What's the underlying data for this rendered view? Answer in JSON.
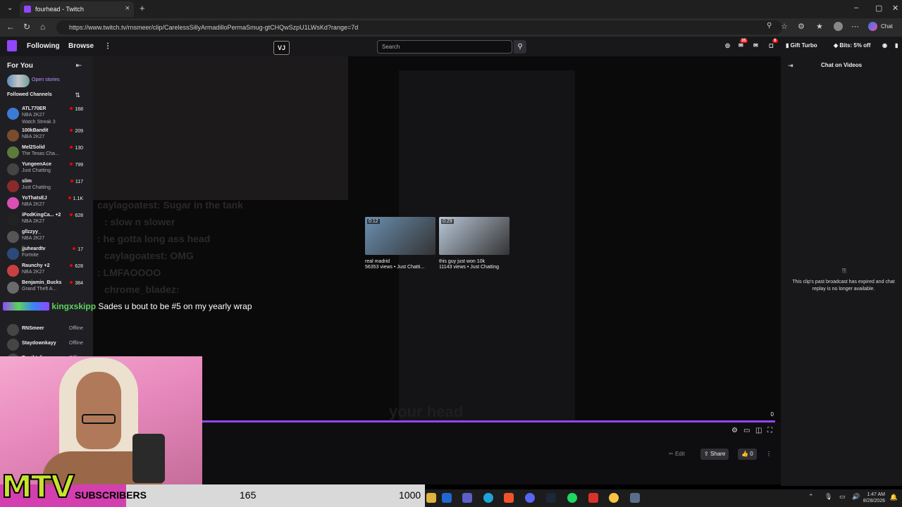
{
  "browser": {
    "tab_title": "fourhead - Twitch",
    "url": "https://www.twitch.tv/rnsmeer/clip/CarelessSillyArmadilloPermaSmug-gtCHQwSzpU1LWsKd?range=7d"
  },
  "twitch_nav": {
    "following": "Following",
    "browse": "Browse",
    "search_placeholder": "Search",
    "notif_count": "35",
    "whisper_count": "6",
    "gift_turbo": "Gift Turbo",
    "bits": "Bits: 5% off"
  },
  "sidebar": {
    "for_you": "For You",
    "open_stories": "Open stories",
    "followed_channels": "Followed Channels",
    "channels": [
      {
        "name": "ATL770ER",
        "game": "NBA 2K27",
        "viewers": "168",
        "sub": "Watch Streak 3",
        "color": "#3a7bd5"
      },
      {
        "name": "100kBandit",
        "game": "NBA 2K27",
        "viewers": "209",
        "color": "#7a4b2c"
      },
      {
        "name": "Mel2Solid",
        "game": "The Texas Cha...",
        "viewers": "130",
        "color": "#5c7a3a"
      },
      {
        "name": "YungeenAce",
        "game": "Just Chatting",
        "viewers": "799",
        "color": "#444444"
      },
      {
        "name": "slim",
        "game": "Just Chatting",
        "viewers": "117",
        "color": "#8a2b2b"
      },
      {
        "name": "YoThatsEJ",
        "game": "NBA 2K27",
        "viewers": "1.1K",
        "color": "#d94fb4"
      },
      {
        "name": "iPodKingCa... +2",
        "game": "NBA 2K27",
        "viewers": "628",
        "color": "#222222"
      },
      {
        "name": "gllzzyy_",
        "game": "NBA 2K27",
        "viewers": "",
        "color": "#555555"
      },
      {
        "name": "jjuheardtv",
        "game": "Fortnite",
        "viewers": "17",
        "color": "#2b4a7a"
      },
      {
        "name": "Raunchy +2",
        "game": "NBA 2K27",
        "viewers": "628",
        "color": "#c94040"
      },
      {
        "name": "Benjamin_Bucks",
        "game": "Grand Theft A...",
        "viewers": "384",
        "color": "#6a6a6a"
      }
    ],
    "offline_channels": [
      {
        "name": "RNSmeer",
        "status": "Offline"
      },
      {
        "name": "Staydownkayy",
        "status": "Offline"
      },
      {
        "name": "Runiktvlive",
        "status": "Offline"
      }
    ]
  },
  "overlay_chat": {
    "user": "kingxskipp",
    "message": "Sades u bout to be #5 on my yearly wrap"
  },
  "video": {
    "ghost_lines": [
      "caylagoatest: Sugar in the tank",
      ": slow n slower",
      ": he gotta long ass head",
      "caylagoatest: OMG",
      ": LMFAOOOO",
      "chrome_bladez:"
    ],
    "ghost_caption": "your head",
    "recommended": [
      {
        "duration": "0:12",
        "title": "real madrid",
        "meta": "56353 views • Just Chatti...",
        "color": "#6a8fb0"
      },
      {
        "duration": "0:29",
        "title": "this guy just won 10k",
        "meta": "11143 views • Just Chatting",
        "color": "#b9c7d8"
      }
    ],
    "time_right": "0"
  },
  "clip_actions": {
    "edit": "Edit",
    "share": "Share",
    "likes": "0"
  },
  "chat": {
    "title": "Chat on Videos",
    "message": "This clip's past broadcast has expired and chat replay is no longer available."
  },
  "stream_overlay": {
    "logo_text": "MTV",
    "subs_label": "SUBSCRIBERS",
    "subs_current": "165",
    "subs_goal": "1000",
    "subs_progress": 0.165
  },
  "taskbar": {
    "time": "1:47 AM",
    "date": "8/28/2026"
  }
}
